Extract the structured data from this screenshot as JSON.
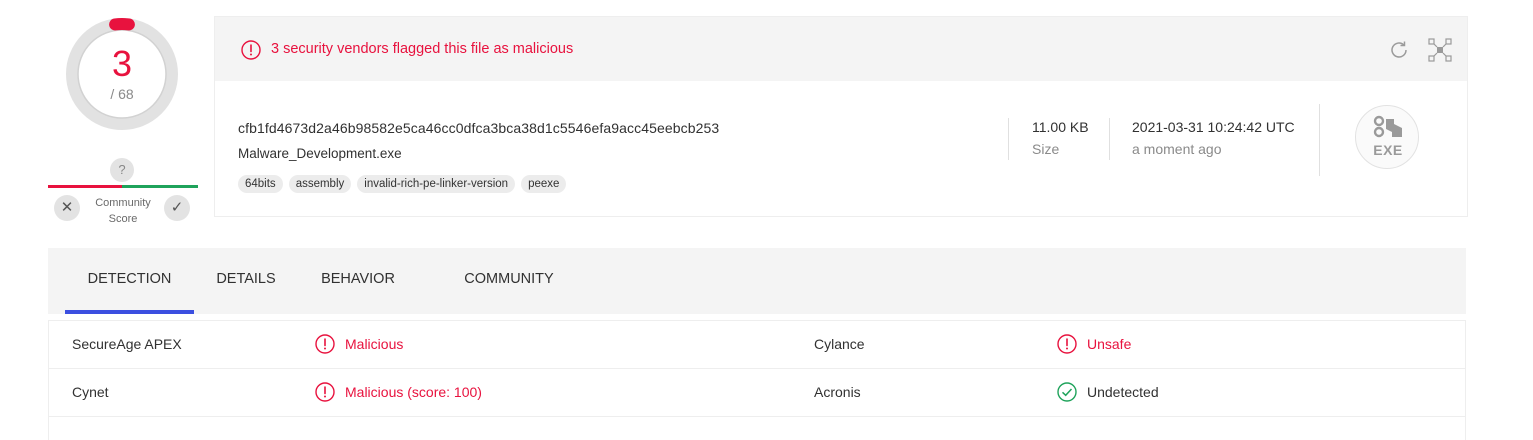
{
  "score": {
    "detections": "3",
    "total": "/ 68",
    "fraction": 0.044
  },
  "community": {
    "help": "?",
    "label": "Community Score",
    "vote_down": "✕",
    "vote_up": "✓"
  },
  "alert": {
    "text": "3 security vendors flagged this file as malicious"
  },
  "file": {
    "hash": "cfb1fd4673d2a46b98582e5ca46cc0dfca3bca38d1c5546efa9acc45eebcb253",
    "name": "Malware_Development.exe",
    "tags": [
      "64bits",
      "assembly",
      "invalid-rich-pe-linker-version",
      "peexe"
    ],
    "size_value": "11.00 KB",
    "size_label": "Size",
    "date_value": "2021-03-31 10:24:42 UTC",
    "date_label": "a moment ago",
    "type": "EXE"
  },
  "tabs": [
    {
      "label": "DETECTION",
      "active": true
    },
    {
      "label": "DETAILS",
      "active": false
    },
    {
      "label": "BEHAVIOR",
      "active": false
    },
    {
      "label": "COMMUNITY",
      "active": false
    }
  ],
  "detections": [
    {
      "engine": "SecureAge APEX",
      "verdict": "Malicious",
      "status": "malicious"
    },
    {
      "engine": "Cylance",
      "verdict": "Unsafe",
      "status": "malicious"
    },
    {
      "engine": "Cynet",
      "verdict": "Malicious (score: 100)",
      "status": "malicious"
    },
    {
      "engine": "Acronis",
      "verdict": "Undetected",
      "status": "undetected"
    }
  ],
  "colors": {
    "malicious": "#e8123e",
    "undetected": "#1fa35b",
    "accent": "#3b4fe0"
  }
}
